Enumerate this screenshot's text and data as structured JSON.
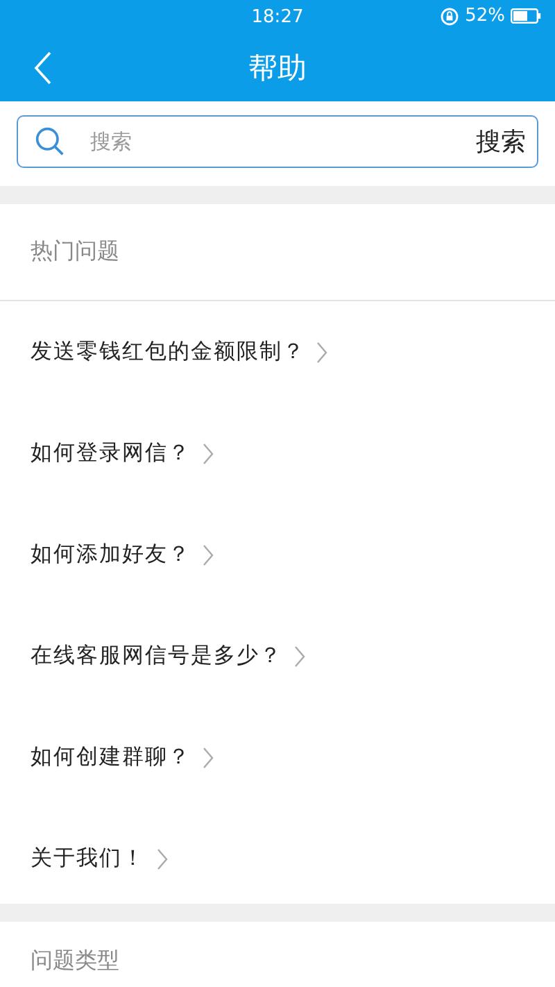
{
  "status_bar": {
    "time": "18:27",
    "battery": "52%"
  },
  "header": {
    "title": "帮助"
  },
  "search": {
    "placeholder": "搜索",
    "button": "搜索"
  },
  "hot_section": {
    "title": "热门问题",
    "items": [
      {
        "label": "发送零钱红包的金额限制？"
      },
      {
        "label": "如何登录网信？"
      },
      {
        "label": "如何添加好友？"
      },
      {
        "label": "在线客服网信号是多少？"
      },
      {
        "label": "如何创建群聊？"
      },
      {
        "label": "关于我们！"
      }
    ]
  },
  "category_section": {
    "title": "问题类型"
  }
}
